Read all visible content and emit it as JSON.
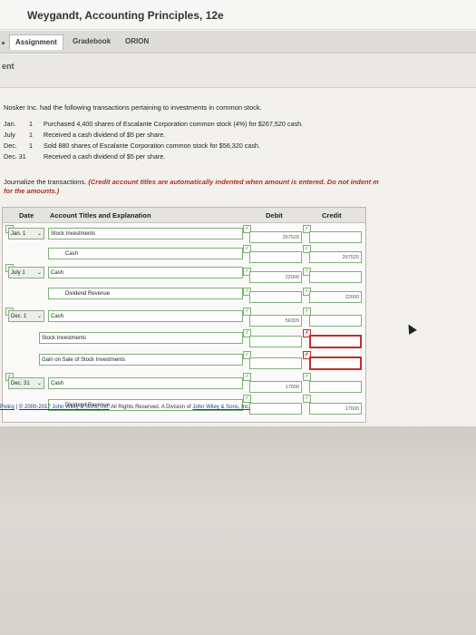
{
  "header": {
    "title": "Weygandt, Accounting Principles, 12e"
  },
  "nav": {
    "tabs": [
      {
        "label": "Assignment"
      },
      {
        "label": "Gradebook"
      },
      {
        "label": "ORION"
      }
    ]
  },
  "section": {
    "label": "ent"
  },
  "problem": {
    "intro": "Nosker Inc. had the following transactions pertaining to investments in common stock.",
    "transactions": [
      {
        "date": "Jan.",
        "day": "1",
        "desc": "Purchased 4,400 shares of Escalante Corporation common stock (4%) for $267,520 cash."
      },
      {
        "date": "July",
        "day": "1",
        "desc": "Received a cash dividend of $5 per share."
      },
      {
        "date": "Dec.",
        "day": "1",
        "desc": "Sold 880 shares of Escalante Corporation common stock for $56,320 cash."
      },
      {
        "date": "Dec. 31",
        "day": "",
        "desc": "Received a cash dividend of $5 per share."
      }
    ],
    "instruction_plain": "Journalize the transactions. ",
    "instruction_red": "(Credit account titles are automatically indented when amount is entered. Do not indent m",
    "instruction_tail": "for the amounts.)"
  },
  "table": {
    "headers": {
      "date": "Date",
      "account": "Account Titles and Explanation",
      "debit": "Debit",
      "credit": "Credit"
    },
    "rows": [
      {
        "date": "Jan. 1",
        "account": "Stock Investments",
        "debit": "267520",
        "credit": ""
      },
      {
        "date": "",
        "account": "Cash",
        "debit": "",
        "credit": "267520"
      },
      {
        "date": "July 1",
        "account": "Cash",
        "debit": "22000",
        "credit": ""
      },
      {
        "date": "",
        "account": "Dividend Revenue",
        "debit": "",
        "credit": "22000"
      },
      {
        "date": "Dec. 1",
        "account": "Cash",
        "debit": "56320",
        "credit": ""
      },
      {
        "date": "",
        "account": "Stock Investments",
        "debit": "",
        "credit": ""
      },
      {
        "date": "",
        "account": "Gain on Sale of Stock Investments",
        "debit": "",
        "credit": ""
      },
      {
        "date": "Dec. 31",
        "account": "Cash",
        "debit": "17600",
        "credit": ""
      },
      {
        "date": "",
        "account": "Dividend Revenue",
        "debit": "",
        "credit": "17600"
      }
    ]
  },
  "footer": {
    "policy": "Policy",
    "sep": " | ",
    "copyright": "© 2000-2017 John Wiley & Sons, Inc.",
    "rights": " All Rights Reserved. A Division of ",
    "company": "John Wiley & Sons, Inc."
  },
  "colors": {
    "accent_green": "#7fb07a",
    "error_red": "#c0302a",
    "instruction_red": "#b03020"
  }
}
